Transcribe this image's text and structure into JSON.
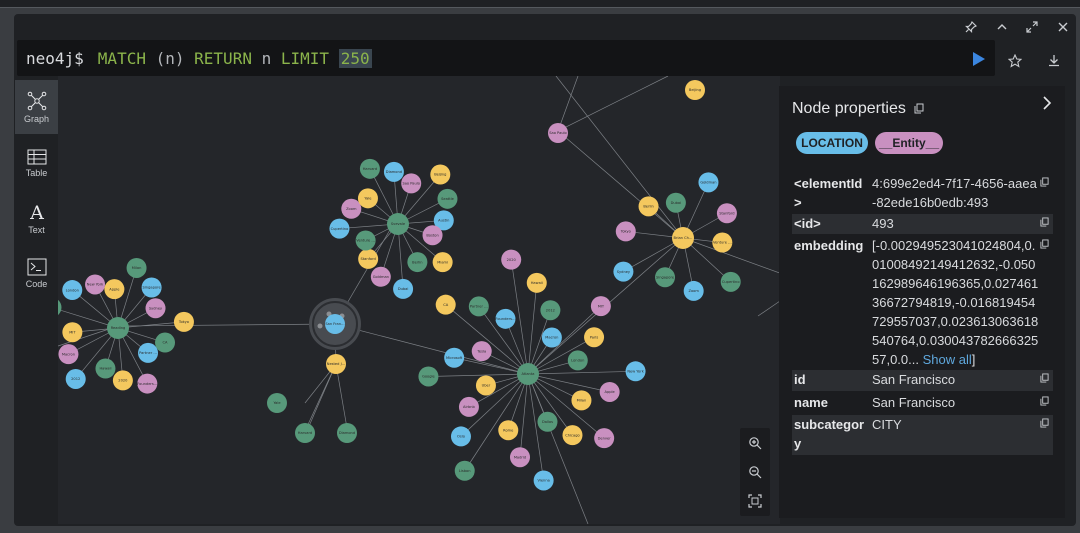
{
  "editor": {
    "prompt": "neo4j$",
    "query_tokens": [
      {
        "text": "MATCH",
        "kind": "kw"
      },
      {
        "text": "(n)",
        "kind": "plain"
      },
      {
        "text": "RETURN",
        "kind": "kw"
      },
      {
        "text": "n",
        "kind": "plain"
      },
      {
        "text": "LIMIT",
        "kind": "kw"
      },
      {
        "text": "250",
        "kind": "num"
      }
    ]
  },
  "sidebar": {
    "items": [
      {
        "label": "Graph",
        "icon": "graph-icon",
        "active": true
      },
      {
        "label": "Table",
        "icon": "table-icon",
        "active": false
      },
      {
        "label": "Text",
        "icon": "text-icon",
        "active": false
      },
      {
        "label": "Code",
        "icon": "code-icon",
        "active": false
      }
    ]
  },
  "colors": {
    "location": "#68bde8",
    "entity": "#c990c0",
    "org": "#57997a",
    "person": "#f4c85e",
    "accent_run": "#3b86e0",
    "link": "#5fa8dd"
  },
  "panel": {
    "title": "Node properties",
    "labels": [
      "LOCATION",
      "__Entity__"
    ],
    "properties": [
      {
        "key": "<elementId>",
        "value": "4:699e2ed4-7f17-4656-aaea-82ede16b0edb:493"
      },
      {
        "key": "<id>",
        "value": "493"
      },
      {
        "key": "embedding",
        "value": "[-0.002949523041024804,0.01008492149412632,-0.050162989646196365,0.02746136672794819,-0.016819454729557037,0.023613063618540764,0.03004378266632557,0.0...",
        "link": "Show all",
        "suffix": "]"
      },
      {
        "key": "id",
        "value": "San Francisco"
      },
      {
        "key": "name",
        "value": "San Francisco"
      },
      {
        "key": "subcategory",
        "value": "CITY"
      }
    ]
  },
  "graph": {
    "hubs": [
      {
        "label": "Reading"
      },
      {
        "label": "Svevale"
      },
      {
        "label": "San Francisco"
      },
      {
        "label": "Nested Jeans"
      },
      {
        "label": "Atlanta"
      },
      {
        "label": "Brian Chesky"
      }
    ],
    "node_labels": [
      "CA",
      "Partner Contract",
      "Founders Fund",
      "2020",
      "Hawaii",
      "2012",
      "Macron",
      "MIT",
      "Paris",
      "London",
      "New York",
      "Apple",
      "Milan",
      "Singapore",
      "Sydney",
      "Tokyo",
      "Berlin",
      "Dubai",
      "Goldman",
      "Stanford",
      "Venture Capital",
      "Cupertino",
      "Zoom",
      "Yale",
      "Harvard",
      "Diamond",
      "Sao Paulo",
      "Beijing",
      "Seattle",
      "Austin",
      "Boston",
      "Miami",
      "Denver",
      "Chicago",
      "Dallas",
      "Vienna",
      "Madrid",
      "Rome",
      "Lisbon",
      "Oslo",
      "Airbnb",
      "Uber",
      "Google",
      "Microsoft",
      "Tesla"
    ]
  }
}
